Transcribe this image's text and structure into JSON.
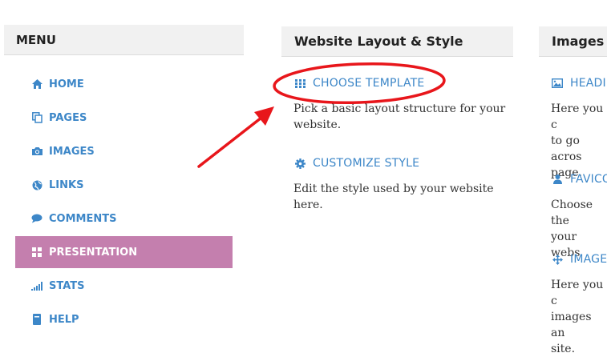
{
  "menu": {
    "title": "MENU",
    "items": [
      {
        "label": "HOME",
        "icon": "home-icon"
      },
      {
        "label": "PAGES",
        "icon": "pages-icon"
      },
      {
        "label": "IMAGES",
        "icon": "camera-icon"
      },
      {
        "label": "LINKS",
        "icon": "globe-icon"
      },
      {
        "label": "COMMENTS",
        "icon": "comment-icon"
      },
      {
        "label": "PRESENTATION",
        "icon": "grid-icon",
        "active": true
      },
      {
        "label": "STATS",
        "icon": "signal-icon"
      },
      {
        "label": "HELP",
        "icon": "help-icon"
      }
    ]
  },
  "layout_panel": {
    "title": "Website Layout & Style",
    "choose_template": {
      "label": "CHOOSE TEMPLATE",
      "desc_line1": "Pick a basic layout structure for your",
      "desc_line2": "website."
    },
    "customize_style": {
      "label": "CUSTOMIZE STYLE",
      "desc_line1": "Edit the style used by your website",
      "desc_line2": "here."
    }
  },
  "images_panel": {
    "title": "Images",
    "header_link": "HEADI",
    "header_desc": [
      "Here you c",
      "to go acros",
      "page."
    ],
    "favicon_link": "FAVICO",
    "favicon_desc": [
      "Choose the",
      "your webs"
    ],
    "image_link": "IMAGE",
    "image_desc": [
      "Here you c",
      "images an",
      "site."
    ]
  },
  "colors": {
    "link": "#3d87c8",
    "active_bg": "#c47fae",
    "annotation": "#e8161b"
  }
}
